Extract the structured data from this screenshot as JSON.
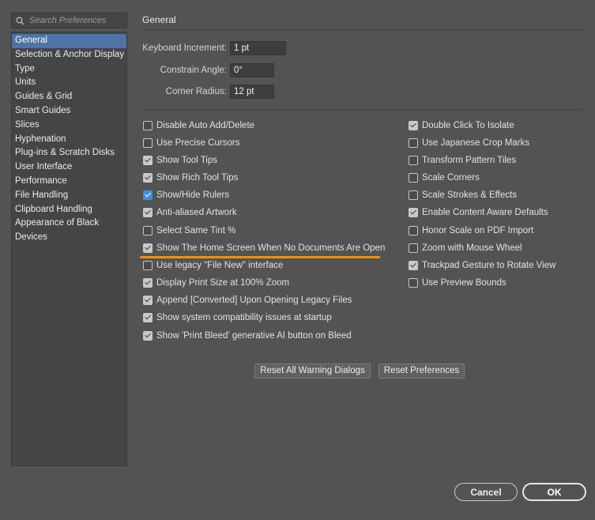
{
  "search": {
    "placeholder": "Search Preferences"
  },
  "sidebar": {
    "items": [
      {
        "label": "General",
        "selected": true
      },
      {
        "label": "Selection & Anchor Display"
      },
      {
        "label": "Type"
      },
      {
        "label": "Units"
      },
      {
        "label": "Guides & Grid"
      },
      {
        "label": "Smart Guides"
      },
      {
        "label": "Slices"
      },
      {
        "label": "Hyphenation"
      },
      {
        "label": "Plug-ins & Scratch Disks"
      },
      {
        "label": "User Interface"
      },
      {
        "label": "Performance"
      },
      {
        "label": "File Handling"
      },
      {
        "label": "Clipboard Handling"
      },
      {
        "label": "Appearance of Black"
      },
      {
        "label": "Devices"
      }
    ]
  },
  "main": {
    "title": "General",
    "fields": {
      "keyboard_increment": {
        "label": "Keyboard Increment:",
        "value": "1 pt"
      },
      "constrain_angle": {
        "label": "Constrain Angle:",
        "value": "0°"
      },
      "corner_radius": {
        "label": "Corner Radius:",
        "value": "12 pt"
      }
    },
    "left_options": [
      {
        "label": "Disable Auto Add/Delete",
        "checked": false
      },
      {
        "label": "Use Precise Cursors",
        "checked": false
      },
      {
        "label": "Show Tool Tips",
        "checked": true
      },
      {
        "label": "Show Rich Tool Tips",
        "checked": true
      },
      {
        "label": "Show/Hide Rulers",
        "checked": true,
        "accent": true
      },
      {
        "label": "Anti-aliased Artwork",
        "checked": true
      },
      {
        "label": "Select Same Tint %",
        "checked": false
      },
      {
        "label": "Show The Home Screen When No Documents Are Open",
        "checked": true
      },
      {
        "label": "Use legacy \"File New\" interface",
        "checked": false
      },
      {
        "label": "Display Print Size at 100% Zoom",
        "checked": true
      },
      {
        "label": "Append [Converted] Upon Opening Legacy Files",
        "checked": true
      },
      {
        "label": "Show system compatibility issues at startup",
        "checked": true
      },
      {
        "label": "Show 'Print Bleed' generative AI button on Bleed",
        "checked": true
      }
    ],
    "right_options": [
      {
        "label": "Double Click To Isolate",
        "checked": true
      },
      {
        "label": "Use Japanese Crop Marks",
        "checked": false
      },
      {
        "label": "Transform Pattern Tiles",
        "checked": false
      },
      {
        "label": "Scale Corners",
        "checked": false
      },
      {
        "label": "Scale Strokes & Effects",
        "checked": false
      },
      {
        "label": "Enable Content Aware Defaults",
        "checked": true
      },
      {
        "label": "Honor Scale on PDF Import",
        "checked": false
      },
      {
        "label": "Zoom with Mouse Wheel",
        "checked": false
      },
      {
        "label": "Trackpad Gesture to Rotate View",
        "checked": true
      },
      {
        "label": "Use Preview Bounds",
        "checked": false
      }
    ],
    "reset_warnings_label": "Reset All Warning Dialogs",
    "reset_prefs_label": "Reset Preferences"
  },
  "footer": {
    "cancel_label": "Cancel",
    "ok_label": "OK"
  },
  "colors": {
    "accent_checkbox": "#3b8fe0",
    "highlight_underline": "#f0910f",
    "selected_item": "#4d74a4"
  }
}
